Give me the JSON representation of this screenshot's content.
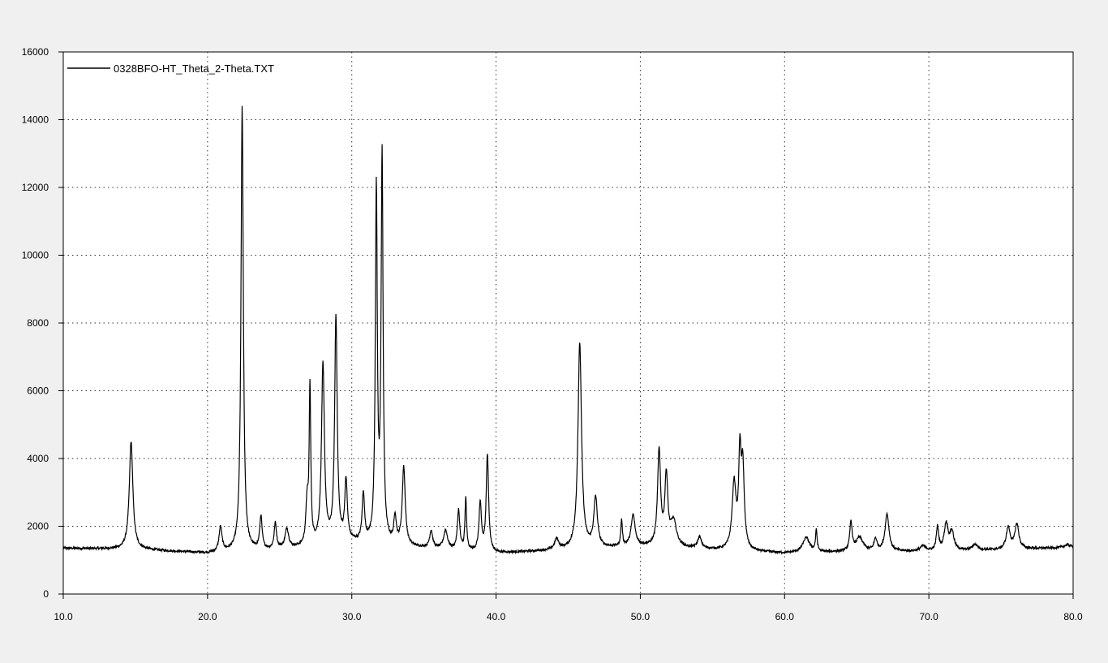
{
  "chart_data": {
    "type": "line",
    "title": "",
    "xlabel": "",
    "ylabel": "",
    "xlim": [
      10.0,
      80.0
    ],
    "ylim": [
      0,
      16000
    ],
    "x_ticks": [
      "10.0",
      "20.0",
      "30.0",
      "40.0",
      "50.0",
      "60.0",
      "70.0",
      "80.0"
    ],
    "y_ticks": [
      "0",
      "2000",
      "4000",
      "6000",
      "8000",
      "10000",
      "12000",
      "14000",
      "16000"
    ],
    "grid": true,
    "legend_position": "top-left",
    "series": [
      {
        "name": "0328BFO-HT_Theta_2-Theta.TXT",
        "color": "#000000",
        "baseline": [
          [
            10,
            1350
          ],
          [
            15,
            1320
          ],
          [
            20,
            1200
          ],
          [
            25,
            1300
          ],
          [
            30,
            1500
          ],
          [
            35,
            1350
          ],
          [
            40,
            1200
          ],
          [
            45,
            1300
          ],
          [
            50,
            1400
          ],
          [
            55,
            1300
          ],
          [
            60,
            1200
          ],
          [
            65,
            1250
          ],
          [
            70,
            1250
          ],
          [
            75,
            1300
          ],
          [
            80,
            1380
          ]
        ],
        "peaks": [
          {
            "x": 14.7,
            "y": 4500,
            "w": 0.18
          },
          {
            "x": 20.9,
            "y": 1950,
            "w": 0.15
          },
          {
            "x": 22.4,
            "y": 14350,
            "w": 0.12
          },
          {
            "x": 23.7,
            "y": 2250,
            "w": 0.12
          },
          {
            "x": 24.7,
            "y": 2050,
            "w": 0.12
          },
          {
            "x": 25.5,
            "y": 1900,
            "w": 0.18
          },
          {
            "x": 26.9,
            "y": 2600,
            "w": 0.12
          },
          {
            "x": 27.1,
            "y": 6000,
            "w": 0.08
          },
          {
            "x": 28.0,
            "y": 6700,
            "w": 0.15
          },
          {
            "x": 28.9,
            "y": 8100,
            "w": 0.13
          },
          {
            "x": 29.6,
            "y": 3250,
            "w": 0.13
          },
          {
            "x": 30.8,
            "y": 2900,
            "w": 0.12
          },
          {
            "x": 31.7,
            "y": 11800,
            "w": 0.1
          },
          {
            "x": 32.1,
            "y": 12800,
            "w": 0.1
          },
          {
            "x": 33.0,
            "y": 2200,
            "w": 0.12
          },
          {
            "x": 33.6,
            "y": 3700,
            "w": 0.15
          },
          {
            "x": 35.5,
            "y": 1850,
            "w": 0.15
          },
          {
            "x": 36.5,
            "y": 1850,
            "w": 0.2
          },
          {
            "x": 37.4,
            "y": 2450,
            "w": 0.12
          },
          {
            "x": 37.9,
            "y": 2800,
            "w": 0.08
          },
          {
            "x": 38.9,
            "y": 2650,
            "w": 0.12
          },
          {
            "x": 39.4,
            "y": 4100,
            "w": 0.12
          },
          {
            "x": 44.2,
            "y": 1600,
            "w": 0.2
          },
          {
            "x": 45.8,
            "y": 7400,
            "w": 0.18
          },
          {
            "x": 46.9,
            "y": 2800,
            "w": 0.18
          },
          {
            "x": 48.7,
            "y": 2150,
            "w": 0.08
          },
          {
            "x": 49.5,
            "y": 2300,
            "w": 0.2
          },
          {
            "x": 51.3,
            "y": 4200,
            "w": 0.15
          },
          {
            "x": 51.8,
            "y": 3400,
            "w": 0.15
          },
          {
            "x": 52.3,
            "y": 2100,
            "w": 0.3
          },
          {
            "x": 54.1,
            "y": 1650,
            "w": 0.2
          },
          {
            "x": 56.5,
            "y": 3200,
            "w": 0.2
          },
          {
            "x": 56.9,
            "y": 3800,
            "w": 0.12
          },
          {
            "x": 57.1,
            "y": 3600,
            "w": 0.15
          },
          {
            "x": 61.5,
            "y": 1650,
            "w": 0.35
          },
          {
            "x": 62.2,
            "y": 1850,
            "w": 0.08
          },
          {
            "x": 64.6,
            "y": 2100,
            "w": 0.12
          },
          {
            "x": 65.2,
            "y": 1650,
            "w": 0.35
          },
          {
            "x": 66.3,
            "y": 1600,
            "w": 0.15
          },
          {
            "x": 67.1,
            "y": 2350,
            "w": 0.2
          },
          {
            "x": 69.6,
            "y": 1400,
            "w": 0.3
          },
          {
            "x": 70.6,
            "y": 1950,
            "w": 0.12
          },
          {
            "x": 71.2,
            "y": 2050,
            "w": 0.2
          },
          {
            "x": 71.6,
            "y": 1800,
            "w": 0.2
          },
          {
            "x": 73.2,
            "y": 1450,
            "w": 0.3
          },
          {
            "x": 75.5,
            "y": 1950,
            "w": 0.2
          },
          {
            "x": 76.1,
            "y": 2050,
            "w": 0.2
          },
          {
            "x": 79.6,
            "y": 1450,
            "w": 0.3
          }
        ]
      }
    ]
  }
}
